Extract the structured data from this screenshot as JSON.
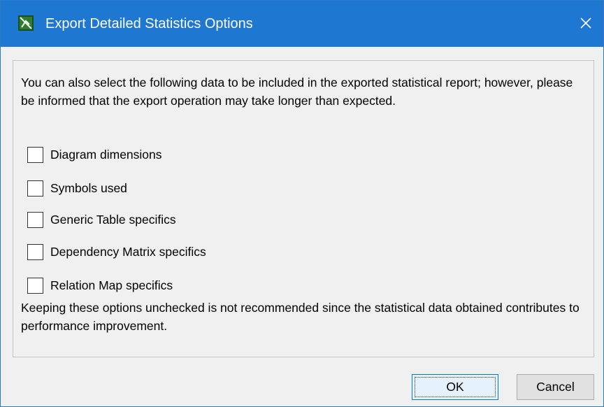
{
  "window": {
    "title": "Export Detailed Statistics Options",
    "app_icon": "magicdraw-app-icon",
    "close_icon": "close-icon",
    "titlebar_color": "#1e78d2"
  },
  "panel": {
    "intro_text": "You can also select the following data to be included in the exported statistical report; however, please be informed that the export operation may take longer than expected.",
    "options": [
      {
        "label": "Diagram dimensions",
        "checked": false
      },
      {
        "label": "Symbols used",
        "checked": false
      },
      {
        "label": "Generic Table specifics",
        "checked": false
      },
      {
        "label": "Dependency Matrix specifics",
        "checked": false
      },
      {
        "label": "Relation Map specifics",
        "checked": false
      }
    ],
    "note_text": "Keeping these options unchecked is not recommended since the statistical data obtained contributes to performance improvement."
  },
  "buttons": {
    "ok_label": "OK",
    "cancel_label": "Cancel"
  }
}
